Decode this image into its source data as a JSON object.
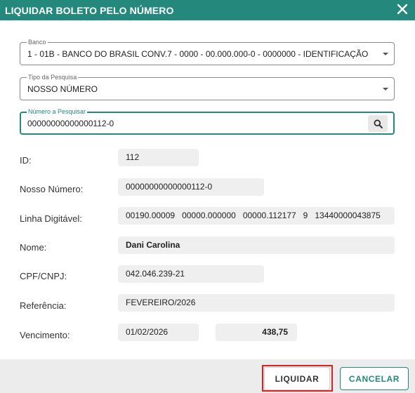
{
  "dialog": {
    "title": "LIQUIDAR BOLETO PELO NÚMERO",
    "close_icon": "close-icon",
    "accent": "#24897c"
  },
  "form": {
    "banco": {
      "label": "Banco",
      "value": "1 - 01B - BANCO DO BRASIL CONV.7 - 0000 - 00.000.000-0 - 0000000 - IDENTIFICAÇÃO"
    },
    "tipo": {
      "label": "Tipo da Pesquisa",
      "value": "NOSSO NÚMERO"
    },
    "numero": {
      "label": "Número a Pesquisar",
      "value": "00000000000000112-0",
      "search_icon": "search-icon"
    }
  },
  "details": {
    "id": {
      "label": "ID:",
      "value": "112"
    },
    "nosso_numero": {
      "label": "Nosso Número:",
      "value": "00000000000000112-0"
    },
    "linha_digitavel": {
      "label": "Linha Digitável:",
      "value": "00190.00009   00000.000000   00000.112177   9   13440000043875"
    },
    "nome": {
      "label": "Nome:",
      "value": "Dani Carolina"
    },
    "cpf_cnpj": {
      "label": "CPF/CNPJ:",
      "value": "042.046.239-21"
    },
    "referencia": {
      "label": "Referência:",
      "value": "FEVEREIRO/2026"
    },
    "vencimento": {
      "label": "Vencimento:",
      "date": "01/02/2026",
      "amount": "438,75"
    }
  },
  "footer": {
    "liquidar_label": "LIQUIDAR",
    "cancelar_label": "CANCELAR"
  }
}
